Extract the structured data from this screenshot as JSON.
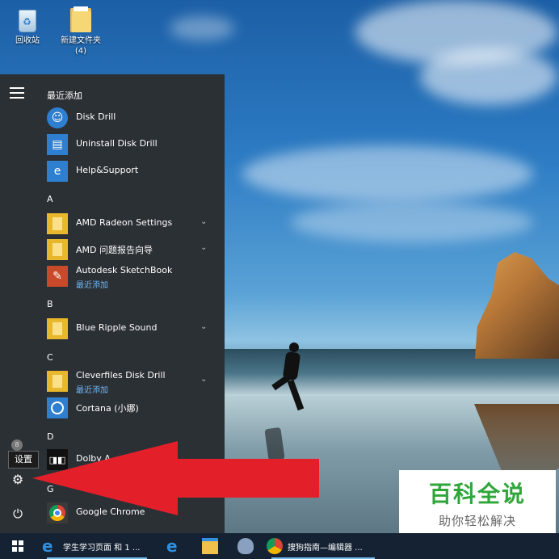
{
  "desktop": {
    "icons": [
      {
        "label": "回收站",
        "icon": "recycle-bin-icon"
      },
      {
        "label": "新建文件夹",
        "label2": "(4)",
        "icon": "folder-icon"
      }
    ]
  },
  "start_menu": {
    "recent_header": "最近添加",
    "recent": [
      {
        "label": "Disk Drill",
        "icon": "disk-drill-icon"
      },
      {
        "label": "Uninstall Disk Drill",
        "icon": "uninstall-icon"
      },
      {
        "label": "Help&Support",
        "icon": "help-icon"
      }
    ],
    "sections": [
      {
        "letter": "A",
        "items": [
          {
            "label": "AMD Radeon Settings",
            "icon": "folder-icon",
            "expand": "⌄"
          },
          {
            "label": "AMD 问题报告向导",
            "icon": "folder-icon",
            "expand": "⌄"
          },
          {
            "label": "Autodesk SketchBook",
            "sub": "最近添加",
            "icon": "sketchbook-icon"
          }
        ]
      },
      {
        "letter": "B",
        "items": [
          {
            "label": "Blue Ripple Sound",
            "icon": "folder-icon",
            "expand": "⌄"
          }
        ]
      },
      {
        "letter": "C",
        "items": [
          {
            "label": "Cleverfiles Disk Drill",
            "sub": "最近添加",
            "icon": "folder-icon",
            "expand": "⌄"
          },
          {
            "label": "Cortana (小娜)",
            "icon": "cortana-icon"
          }
        ]
      },
      {
        "letter": "D",
        "items": [
          {
            "label": "Dolby A",
            "icon": "dolby-icon"
          }
        ]
      },
      {
        "letter": "G",
        "items": [
          {
            "label": "Google Chrome",
            "icon": "chrome-icon"
          }
        ]
      }
    ],
    "rail": {
      "settings_tooltip": "设置",
      "user_glyph": "8"
    }
  },
  "watermark": {
    "title": "百科全说",
    "subtitle": "助你轻松解决"
  },
  "taskbar": {
    "items": [
      {
        "label": "学生学习页面 和 1 ...",
        "icon": "ie-icon"
      },
      {
        "label": "",
        "icon": "ie-icon"
      },
      {
        "label": "",
        "icon": "file-explorer-icon"
      },
      {
        "label": "",
        "icon": "sogou-icon"
      },
      {
        "label": "搜狗指南—编辑器 ...",
        "icon": "chrome-icon"
      }
    ]
  },
  "colors": {
    "start_bg": "#2b3035",
    "taskbar_bg": "#152233",
    "accent_blue": "#6fb8f5",
    "arrow_red": "#e3202a",
    "watermark_green": "#2fa63a"
  }
}
